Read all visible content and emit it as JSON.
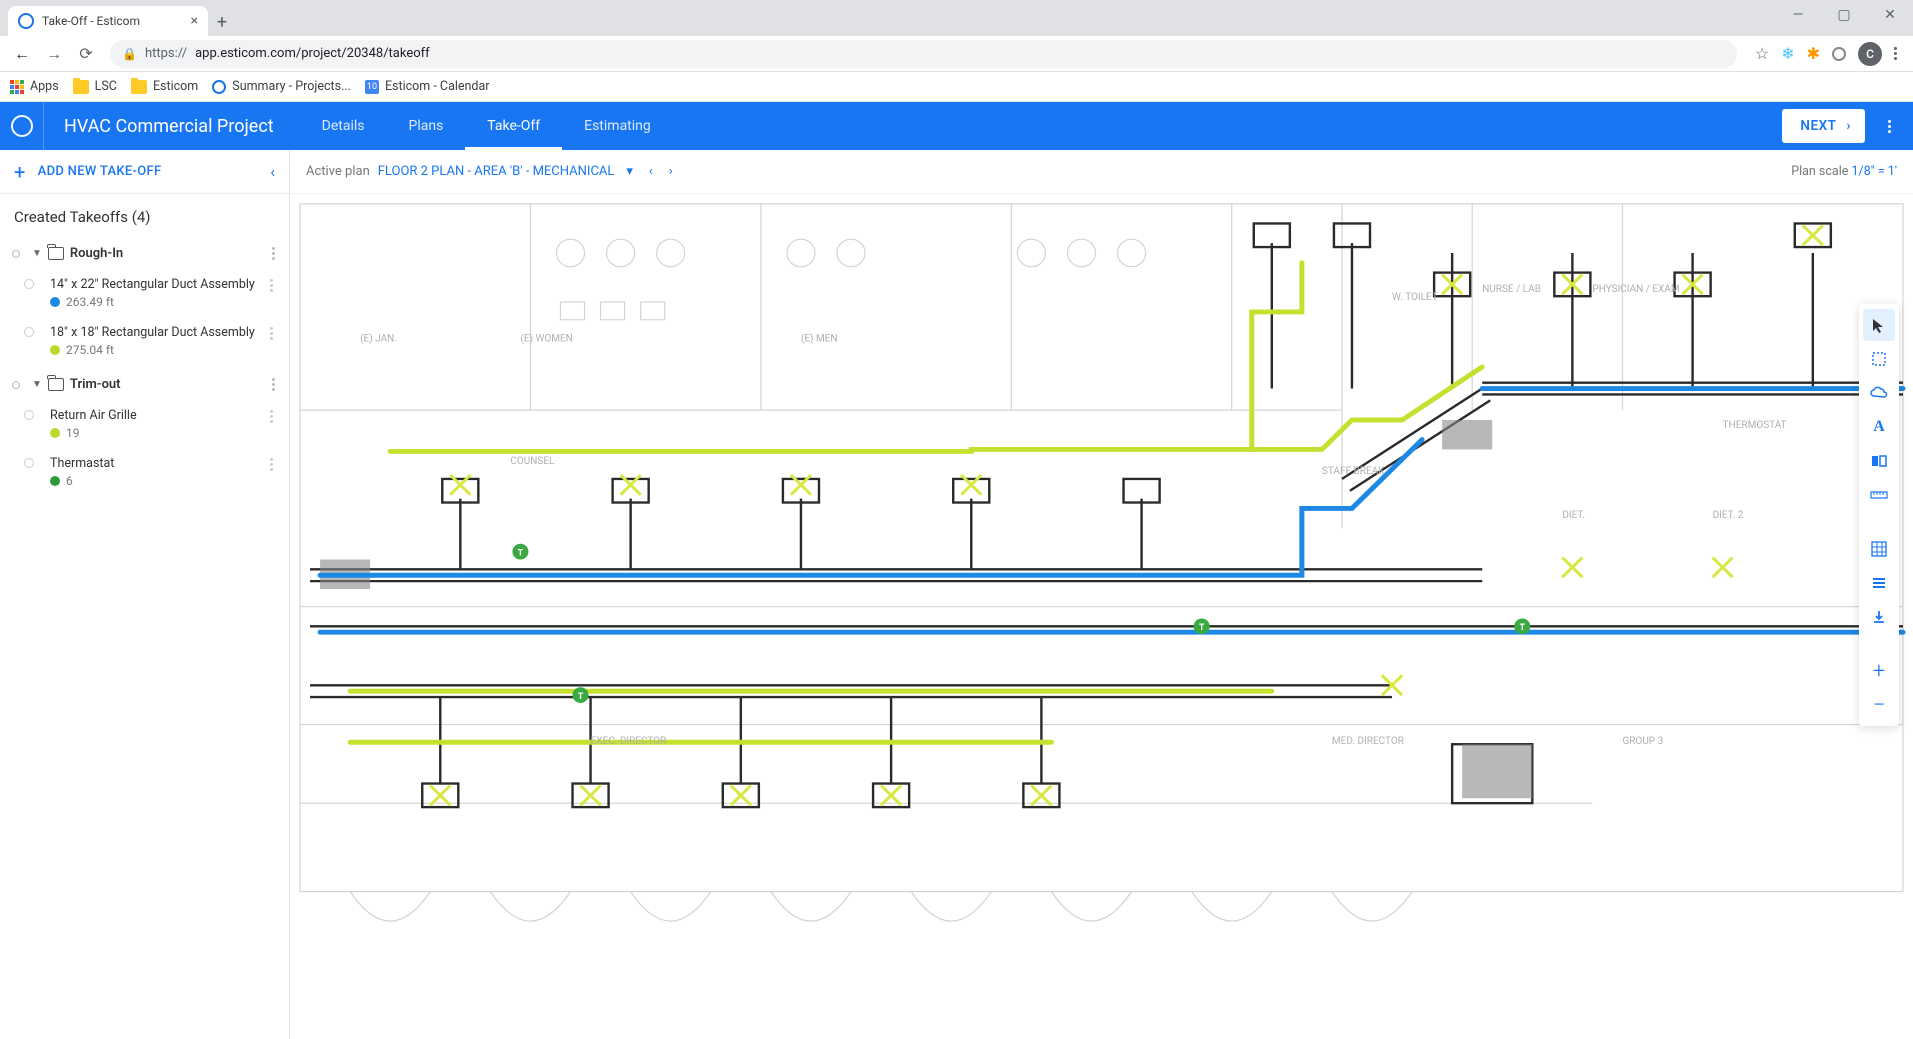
{
  "browser": {
    "tab_title": "Take-Off - Esticom",
    "url_prefix": "https://",
    "url": "app.esticom.com/project/20348/takeoff",
    "bookmarks": [
      {
        "label": "Apps",
        "type": "apps"
      },
      {
        "label": "LSC",
        "type": "folder"
      },
      {
        "label": "Esticom",
        "type": "folder"
      },
      {
        "label": "Summary - Projects...",
        "type": "esticom"
      },
      {
        "label": "Esticom - Calendar",
        "type": "cal"
      }
    ],
    "avatar_letter": "C"
  },
  "header": {
    "project_title": "HVAC Commercial Project",
    "tabs": [
      "Details",
      "Plans",
      "Take-Off",
      "Estimating"
    ],
    "active_tab": "Take-Off",
    "next_label": "NEXT"
  },
  "sidebar": {
    "add_label": "ADD NEW TAKE-OFF",
    "created_label": "Created Takeoffs (4)",
    "groups": [
      {
        "name": "Rough-In",
        "items": [
          {
            "name": "14\" x 22\" Rectangular Duct Assembly",
            "value": "263.49 ft",
            "color": "#1e88e5"
          },
          {
            "name": "18\" x 18\" Rectangular Duct Assembly",
            "value": "275.04 ft",
            "color": "#c0d72e"
          }
        ]
      },
      {
        "name": "Trim-out",
        "items": [
          {
            "name": "Return Air Grille",
            "value": "19",
            "color": "#c0d72e"
          },
          {
            "name": "Thermastat",
            "value": "6",
            "color": "#2e9a3a"
          }
        ]
      }
    ]
  },
  "canvas": {
    "active_plan_label": "Active plan",
    "plan_name": "FLOOR 2 PLAN - AREA 'B' - MECHANICAL",
    "scale_label": "Plan scale",
    "scale_value": "1/8\" = 1'",
    "tools": [
      {
        "name": "cursor",
        "glyph": "↖",
        "active": true
      },
      {
        "name": "select-rect",
        "glyph": "▦"
      },
      {
        "name": "cloud",
        "glyph": "☁"
      },
      {
        "name": "text",
        "glyph": "A"
      },
      {
        "name": "compare",
        "glyph": "◧"
      },
      {
        "name": "measure",
        "glyph": "📏"
      },
      {
        "name": "grid",
        "glyph": "▦"
      },
      {
        "name": "layers",
        "glyph": "☰"
      },
      {
        "name": "download",
        "glyph": "⬇"
      },
      {
        "name": "zoom-in",
        "glyph": "+"
      },
      {
        "name": "zoom-out",
        "glyph": "−"
      }
    ],
    "room_labels": {
      "jan": "(E) JAN.",
      "women": "(E) WOMEN",
      "men": "(E) MEN",
      "wtoilet": "W. TOILET",
      "nurselab": "NURSE / LAB",
      "physician": "PHYSICIAN / EXAM",
      "staffbreak": "STAFF BREAK",
      "diet": "DIET.",
      "diet2": "DIET. 2",
      "execdir": "EXEC. DIRECTOR",
      "meddir": "MED. DIRECTOR",
      "group3": "GROUP 3",
      "thermostat": "THERMOSTAT",
      "counsel": "COUNSEL"
    }
  }
}
